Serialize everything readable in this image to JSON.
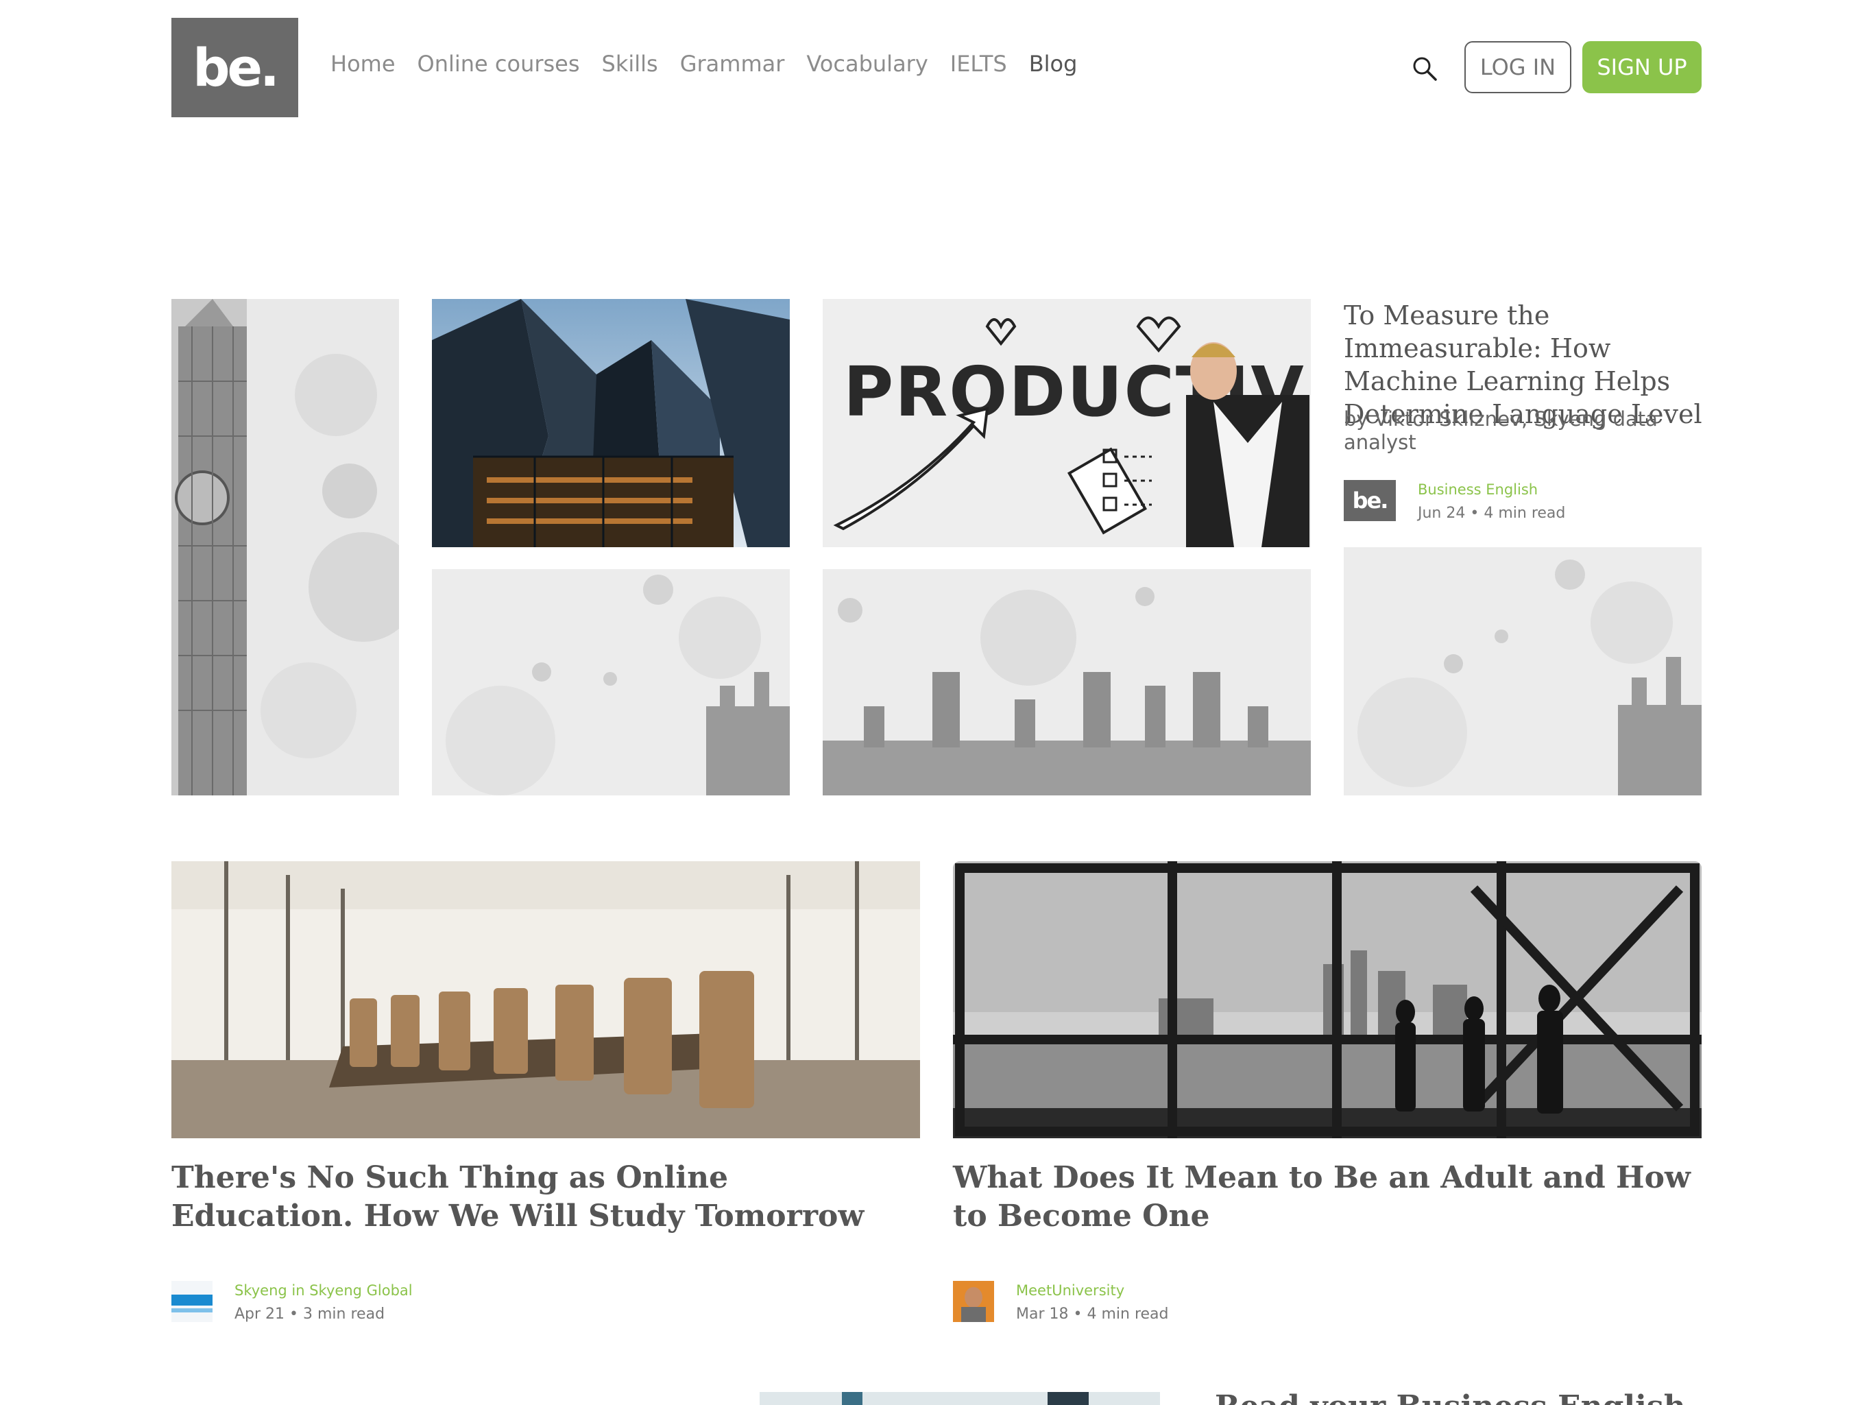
{
  "brand": {
    "logo_text": "be."
  },
  "nav": {
    "items": [
      "Home",
      "Online courses",
      "Skills",
      "Grammar",
      "Vocabulary",
      "IELTS",
      "Blog"
    ],
    "active": "Blog"
  },
  "header": {
    "search_icon": "search-icon",
    "login_label": "LOG IN",
    "signup_label": "SIGN UP"
  },
  "colors": {
    "accent": "#8bc34a",
    "logo_bg": "#6a6a6a",
    "text": "#555555"
  },
  "featured": {
    "title": "To Measure the Immeasurable: How Machine Learning Helps Determine Language Level",
    "author": "by Viktor Skliznev, Skyeng data analyst",
    "publisher_logo": "be.",
    "category": "Business English",
    "date": "Jun 24",
    "read_time": "4 min read"
  },
  "cards": [
    {
      "title": "There's No Such Thing as Online Education. How We Will Study Tomorrow",
      "source": "Skyeng in Skyeng Global",
      "date": "Apr 21",
      "read_time": "3 min read"
    },
    {
      "title": "What Does It Mean to Be an Adult and How to Become One",
      "source": "MeetUniversity",
      "date": "Mar 18",
      "read_time": "4 min read"
    }
  ],
  "next_card": {
    "title_partial": "Read your Business English"
  },
  "separator": " • "
}
